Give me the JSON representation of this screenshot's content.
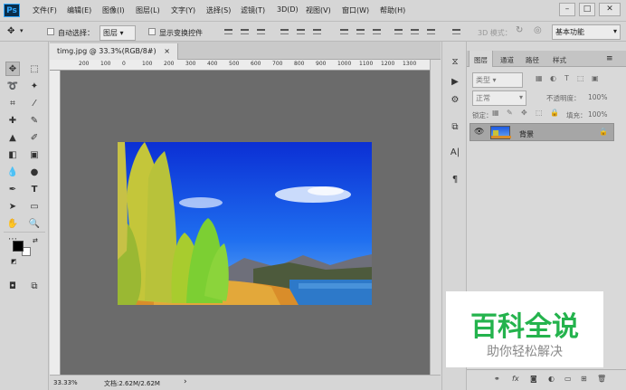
{
  "app": {
    "logo": "Ps",
    "menu": [
      "文件(F)",
      "编辑(E)",
      "图像(I)",
      "图层(L)",
      "文字(Y)",
      "选择(S)",
      "滤镜(T)",
      "3D(D)",
      "视图(V)",
      "窗口(W)",
      "帮助(H)"
    ],
    "window_buttons": {
      "minimize": "–",
      "maximize": "□",
      "close": "✕"
    }
  },
  "options": {
    "auto_select_label": "自动选择：",
    "auto_select_value": "图层",
    "show_transform_label": "显示变换控件",
    "mode_3d_label": "3D 模式：",
    "workspace": "基本功能"
  },
  "document": {
    "tab_title": "timg.jpg @ 33.3%(RGB/8#)",
    "tab_close": "×",
    "ruler_top": [
      "200",
      "100",
      "0",
      "100",
      "200",
      "300",
      "400",
      "500",
      "600",
      "700",
      "800",
      "900",
      "1000",
      "1100",
      "1200",
      "1300"
    ],
    "zoom": "33.33%",
    "doc_info": "文档:2.62M/2.62M"
  },
  "layers_panel": {
    "tabs": [
      "图层",
      "通道",
      "路径",
      "样式"
    ],
    "kind_filter": "类型",
    "blend_mode": "正常",
    "opacity_label": "不透明度：",
    "opacity_value": "100%",
    "lock_label": "锁定：",
    "fill_label": "填充：",
    "fill_value": "100%",
    "layer_name": "背景"
  },
  "watermark": {
    "title": "百科全说",
    "subtitle": "助你轻松解决"
  },
  "colors": {
    "accent": "#31a8ff",
    "watermark_green": "#24b34d",
    "canvas_bg": "#6b6b6b"
  }
}
